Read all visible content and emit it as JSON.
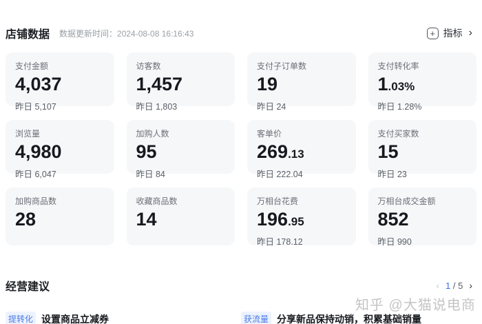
{
  "header": {
    "title": "店铺数据",
    "update_time": "数据更新时间：2024-08-08 16:16:43",
    "metric_button": {
      "icon": "+",
      "label": "指标",
      "chevron": "›"
    }
  },
  "cards": [
    {
      "label": "支付金额",
      "value_main": "4,037",
      "value_sub": "",
      "yesterday": "昨日 5,107"
    },
    {
      "label": "访客数",
      "value_main": "1,457",
      "value_sub": "",
      "yesterday": "昨日 1,803"
    },
    {
      "label": "支付子订单数",
      "value_main": "19",
      "value_sub": "",
      "yesterday": "昨日 24"
    },
    {
      "label": "支付转化率",
      "value_main": "1",
      "value_sub": ".03%",
      "yesterday": "昨日 1.28%"
    },
    {
      "label": "浏览量",
      "value_main": "4,980",
      "value_sub": "",
      "yesterday": "昨日 6,047"
    },
    {
      "label": "加购人数",
      "value_main": "95",
      "value_sub": "",
      "yesterday": "昨日 84"
    },
    {
      "label": "客单价",
      "value_main": "269",
      "value_sub": ".13",
      "yesterday": "昨日 222.04"
    },
    {
      "label": "支付买家数",
      "value_main": "15",
      "value_sub": "",
      "yesterday": "昨日 23"
    },
    {
      "label": "加购商品数",
      "value_main": "28",
      "value_sub": "",
      "yesterday": ""
    },
    {
      "label": "收藏商品数",
      "value_main": "14",
      "value_sub": "",
      "yesterday": ""
    },
    {
      "label": "万相台花费",
      "value_main": "196",
      "value_sub": ".95",
      "yesterday": "昨日 178.12"
    },
    {
      "label": "万相台成交金额",
      "value_main": "852",
      "value_sub": "",
      "yesterday": "昨日 990"
    }
  ],
  "suggestions": {
    "title": "经营建议",
    "pagination": {
      "prev": "‹",
      "current": "1",
      "rest": "/ 5",
      "next": "›"
    },
    "items": [
      {
        "tag": "提转化",
        "text": "设置商品立减券"
      },
      {
        "tag": "获流量",
        "text": "分享新品保持动销，积累基础销量"
      }
    ]
  },
  "watermark": "知乎 @大猫说电商",
  "colors": {
    "card_bg": "#f6f7f9",
    "accent_blue": "#3a6ef0",
    "tag_bg": "#edf3fe",
    "value_text": "#17191f",
    "label_text": "#6a6f77"
  }
}
